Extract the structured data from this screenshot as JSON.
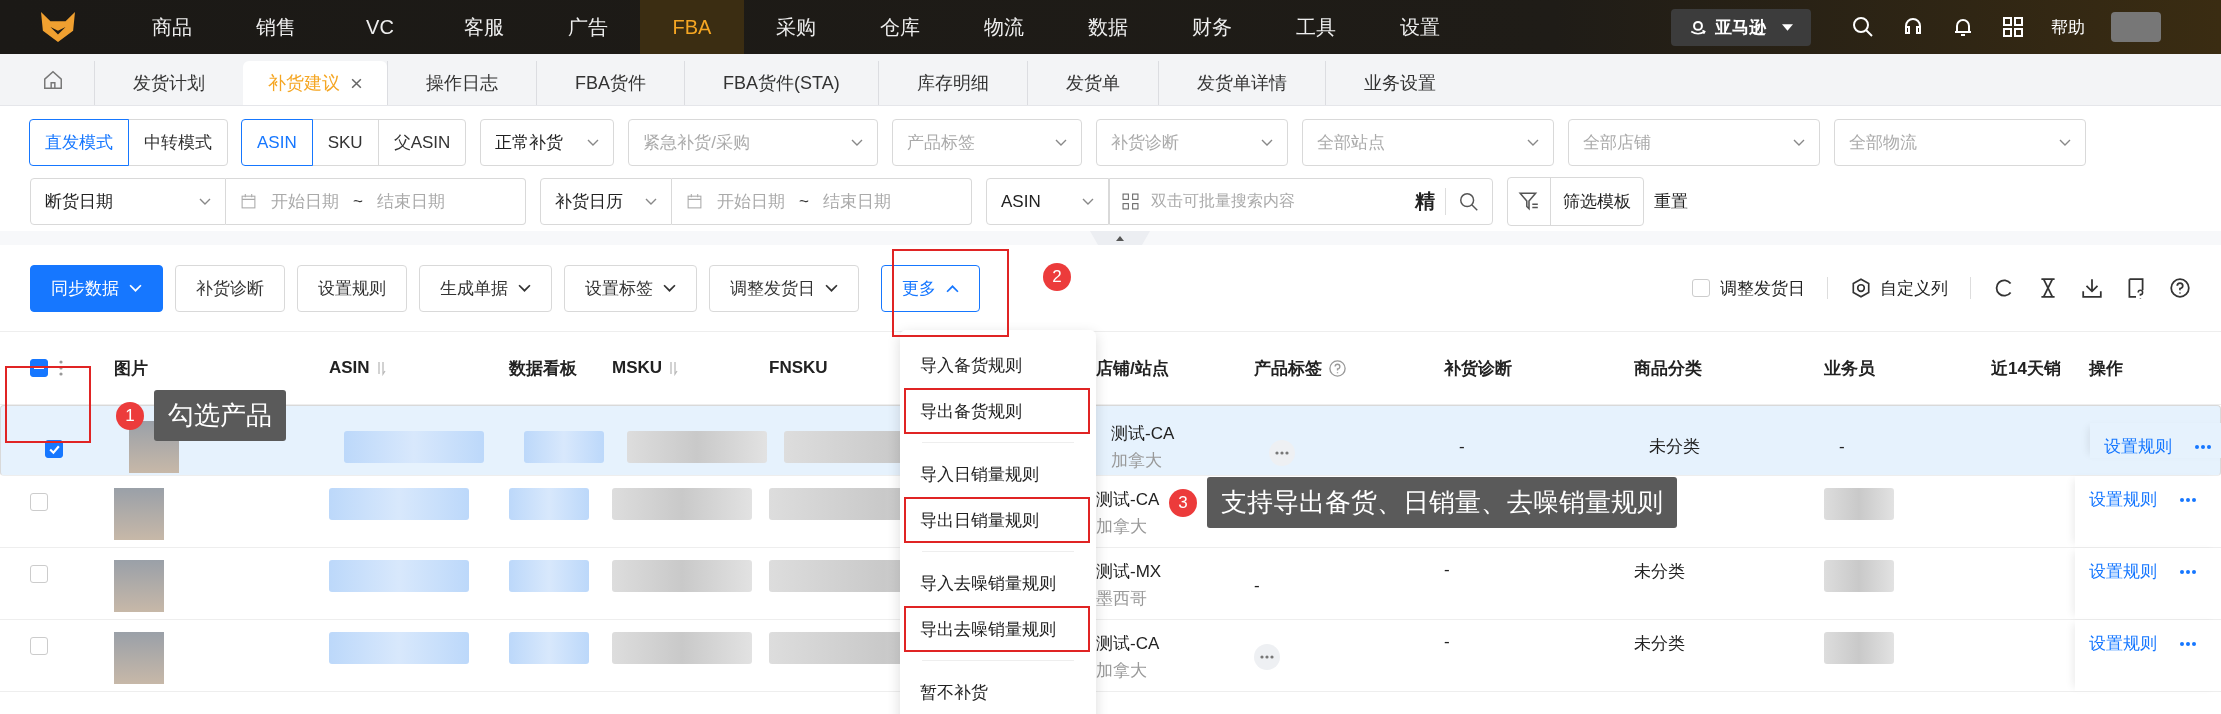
{
  "nav": {
    "items": [
      {
        "label": "商品",
        "selected": false
      },
      {
        "label": "销售",
        "selected": false
      },
      {
        "label": "VC",
        "selected": false
      },
      {
        "label": "客服",
        "selected": false
      },
      {
        "label": "广告",
        "selected": false
      },
      {
        "label": "FBA",
        "selected": true
      },
      {
        "label": "采购",
        "selected": false
      },
      {
        "label": "仓库",
        "selected": false
      },
      {
        "label": "物流",
        "selected": false
      },
      {
        "label": "数据",
        "selected": false
      },
      {
        "label": "财务",
        "selected": false
      },
      {
        "label": "工具",
        "selected": false
      },
      {
        "label": "设置",
        "selected": false
      }
    ],
    "platform": "亚马逊",
    "help": "帮助"
  },
  "tabs": [
    {
      "label": "发货计划",
      "selected": false,
      "closable": false
    },
    {
      "label": "补货建议",
      "selected": true,
      "closable": true
    },
    {
      "label": "操作日志",
      "selected": false,
      "closable": false
    },
    {
      "label": "FBA货件",
      "selected": false,
      "closable": false
    },
    {
      "label": "FBA货件(STA)",
      "selected": false,
      "closable": false
    },
    {
      "label": "库存明细",
      "selected": false,
      "closable": false
    },
    {
      "label": "发货单",
      "selected": false,
      "closable": false
    },
    {
      "label": "发货单详情",
      "selected": false,
      "closable": false
    },
    {
      "label": "业务设置",
      "selected": false,
      "closable": false
    }
  ],
  "filters": {
    "mode": [
      {
        "label": "直发模式",
        "selected": true
      },
      {
        "label": "中转模式",
        "selected": false
      }
    ],
    "id_type": [
      {
        "label": "ASIN",
        "selected": true
      },
      {
        "label": "SKU",
        "selected": false
      },
      {
        "label": "父ASIN",
        "selected": false
      }
    ],
    "selects": [
      {
        "value": "正常补货"
      },
      {
        "placeholder": "紧急补货/采购"
      },
      {
        "placeholder": "产品标签"
      },
      {
        "placeholder": "补货诊断"
      },
      {
        "placeholder": "全部站点"
      },
      {
        "placeholder": "全部店铺"
      },
      {
        "placeholder": "全部物流"
      }
    ],
    "row2": [
      {
        "kind": "select",
        "value": "断货日期"
      },
      {
        "kind": "date_range",
        "start": "开始日期",
        "separator": "~",
        "end": "结束日期"
      },
      {
        "kind": "select",
        "value": "补货日历"
      },
      {
        "kind": "date_range",
        "start": "开始日期",
        "separator": "~",
        "end": "结束日期"
      },
      {
        "kind": "select",
        "value": "ASIN"
      },
      {
        "kind": "search",
        "placeholder": "双击可批量搜索内容",
        "mode": "精"
      },
      {
        "kind": "template",
        "label": "筛选模板"
      },
      {
        "kind": "link",
        "label": "重置"
      }
    ]
  },
  "toolbar": {
    "buttons": [
      {
        "label": "同步数据",
        "kind": "primary",
        "dropdown": true,
        "expanded": false
      },
      {
        "label": "补货诊断",
        "kind": "default",
        "dropdown": false
      },
      {
        "label": "设置规则",
        "kind": "default",
        "dropdown": false
      },
      {
        "label": "生成单据",
        "kind": "default",
        "dropdown": true,
        "expanded": false
      },
      {
        "label": "设置标签",
        "kind": "default",
        "dropdown": true,
        "expanded": false
      },
      {
        "label": "调整发货日",
        "kind": "default",
        "dropdown": true,
        "expanded": false
      },
      {
        "label": "更多",
        "kind": "outline",
        "dropdown": true,
        "expanded": true
      }
    ],
    "checkbox": {
      "label": "调整发货日",
      "checked": false
    },
    "columns_button": "自定义列"
  },
  "table": {
    "columns": [
      {
        "label": "图片",
        "kind": "plain"
      },
      {
        "label": "ASIN",
        "kind": "sortable"
      },
      {
        "label": "数据看板",
        "kind": "plain"
      },
      {
        "label": "MSKU",
        "kind": "sortable"
      },
      {
        "label": "FNSKU",
        "kind": "plain"
      },
      {
        "label": "店铺/站点",
        "kind": "plain"
      },
      {
        "label": "产品标签",
        "kind": "help"
      },
      {
        "label": "补货诊断",
        "kind": "plain"
      },
      {
        "label": "商品分类",
        "kind": "plain"
      },
      {
        "label": "业务员",
        "kind": "plain"
      },
      {
        "label": "近14天销",
        "kind": "plain"
      },
      {
        "label": "操作",
        "kind": "plain"
      }
    ],
    "header_indeterminate": true,
    "rows": [
      {
        "selected": true,
        "store": "测试-CA",
        "site": "加拿大",
        "tag_more": true,
        "diagnosis": "-",
        "category": "未分类",
        "salesperson": "-",
        "action": "设置规则"
      },
      {
        "selected": false,
        "store": "测试-CA",
        "site": "加拿大",
        "action": "设置规则"
      },
      {
        "selected": false,
        "store": "测试-MX",
        "site": "墨西哥",
        "tag": "-",
        "tag_more": false,
        "diagnosis": "-",
        "category": "未分类",
        "action": "设置规则"
      },
      {
        "selected": false,
        "store": "测试-CA",
        "site": "加拿大",
        "tag_more": true,
        "diagnosis": "-",
        "category": "未分类",
        "action": "设置规则"
      }
    ]
  },
  "menu": {
    "groups": [
      [
        {
          "label": "导入备货规则",
          "highlighted": false
        },
        {
          "label": "导出备货规则",
          "highlighted": true
        }
      ],
      [
        {
          "label": "导入日销量规则",
          "highlighted": false
        },
        {
          "label": "导出日销量规则",
          "highlighted": true
        }
      ],
      [
        {
          "label": "导入去噪销量规则",
          "highlighted": false
        },
        {
          "label": "导出去噪销量规则",
          "highlighted": true
        }
      ],
      [
        {
          "label": "暂不补货",
          "highlighted": false
        }
      ]
    ]
  },
  "annotations": [
    {
      "number": "1",
      "text": "勾选产品"
    },
    {
      "number": "2"
    },
    {
      "number": "3",
      "text": "支持导出备货、日销量、去噪销量规则"
    }
  ]
}
